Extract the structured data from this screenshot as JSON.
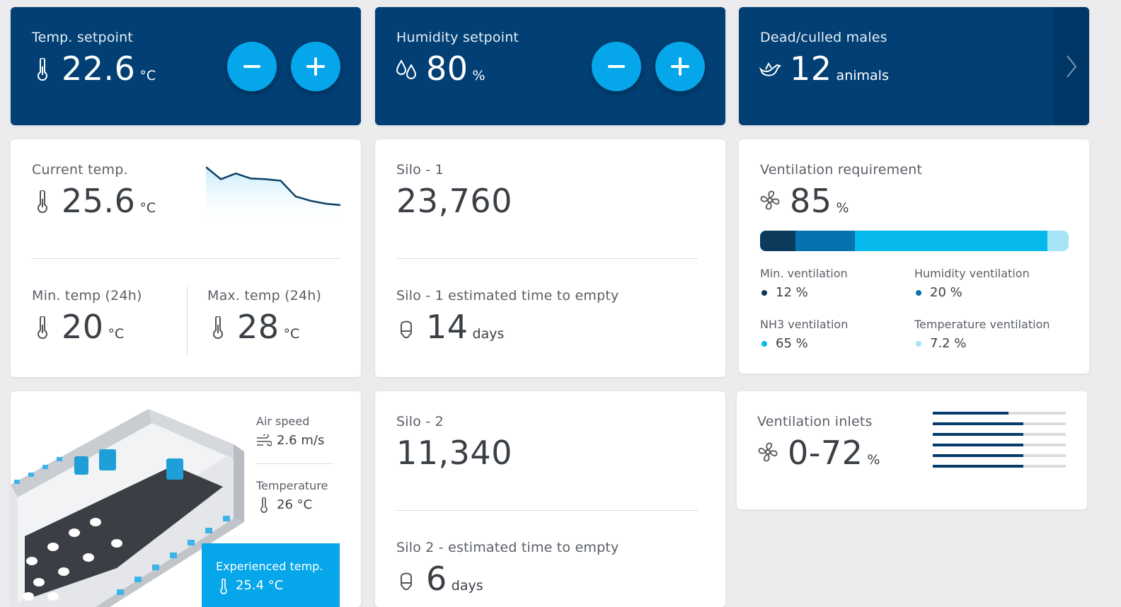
{
  "temp_setpoint": {
    "label": "Temp. setpoint",
    "value": "22.6",
    "unit": "°C"
  },
  "humidity_setpoint": {
    "label": "Humidity setpoint",
    "value": "80",
    "unit": "%"
  },
  "dead_culled": {
    "label": "Dead/culled males",
    "value": "12",
    "unit": "animals"
  },
  "current_temp": {
    "label": "Current temp.",
    "value": "25.6",
    "unit": "°C",
    "min_label": "Min. temp (24h)",
    "min_value": "20",
    "min_unit": "°C",
    "max_label": "Max. temp (24h)",
    "max_value": "28",
    "max_unit": "°C",
    "trend": [
      29.5,
      27.8,
      28.6,
      27.9,
      27.8,
      27.6,
      25.4,
      24.8,
      24.4,
      24.2
    ]
  },
  "silo1": {
    "label": "Silo - 1",
    "value": "23,760",
    "eta_label": "Silo - 1 estimated time to empty",
    "eta_value": "14",
    "eta_unit": "days"
  },
  "silo2": {
    "label": "Silo - 2",
    "value": "11,340",
    "eta_label": "Silo 2 - estimated time to empty",
    "eta_value": "6",
    "eta_unit": "days"
  },
  "ventilation_requirement": {
    "label": "Ventilation requirement",
    "value": "85",
    "unit": "%",
    "segments": [
      {
        "label": "Min. ventilation",
        "value": "12 %",
        "pct": 12,
        "color": "#0b3a5b"
      },
      {
        "label": "Humidity ventilation",
        "value": "20 %",
        "pct": 20,
        "color": "#0573ad"
      },
      {
        "label": "NH3 ventilation",
        "value": "65 %",
        "pct": 65,
        "color": "#05b9ec"
      },
      {
        "label": "Temperature ventilation",
        "value": "7.2 %",
        "pct": 7.2,
        "color": "#a5e3f7"
      }
    ]
  },
  "ventilation_inlets": {
    "label": "Ventilation inlets",
    "value": "0-72",
    "unit": "%",
    "bars": [
      0.57,
      0.68,
      0.68,
      0.68,
      0.68,
      0.68
    ]
  },
  "house": {
    "air_speed_label": "Air speed",
    "air_speed_value": "2.6 m/s",
    "temperature_label": "Temperature",
    "temperature_value": "26 °C",
    "experienced_label": "Experienced temp.",
    "experienced_value": "25.4 °C"
  },
  "colors": {
    "dark_card": "#023f74",
    "accent": "#05a6ea",
    "trend_line": "#0a3d66"
  }
}
